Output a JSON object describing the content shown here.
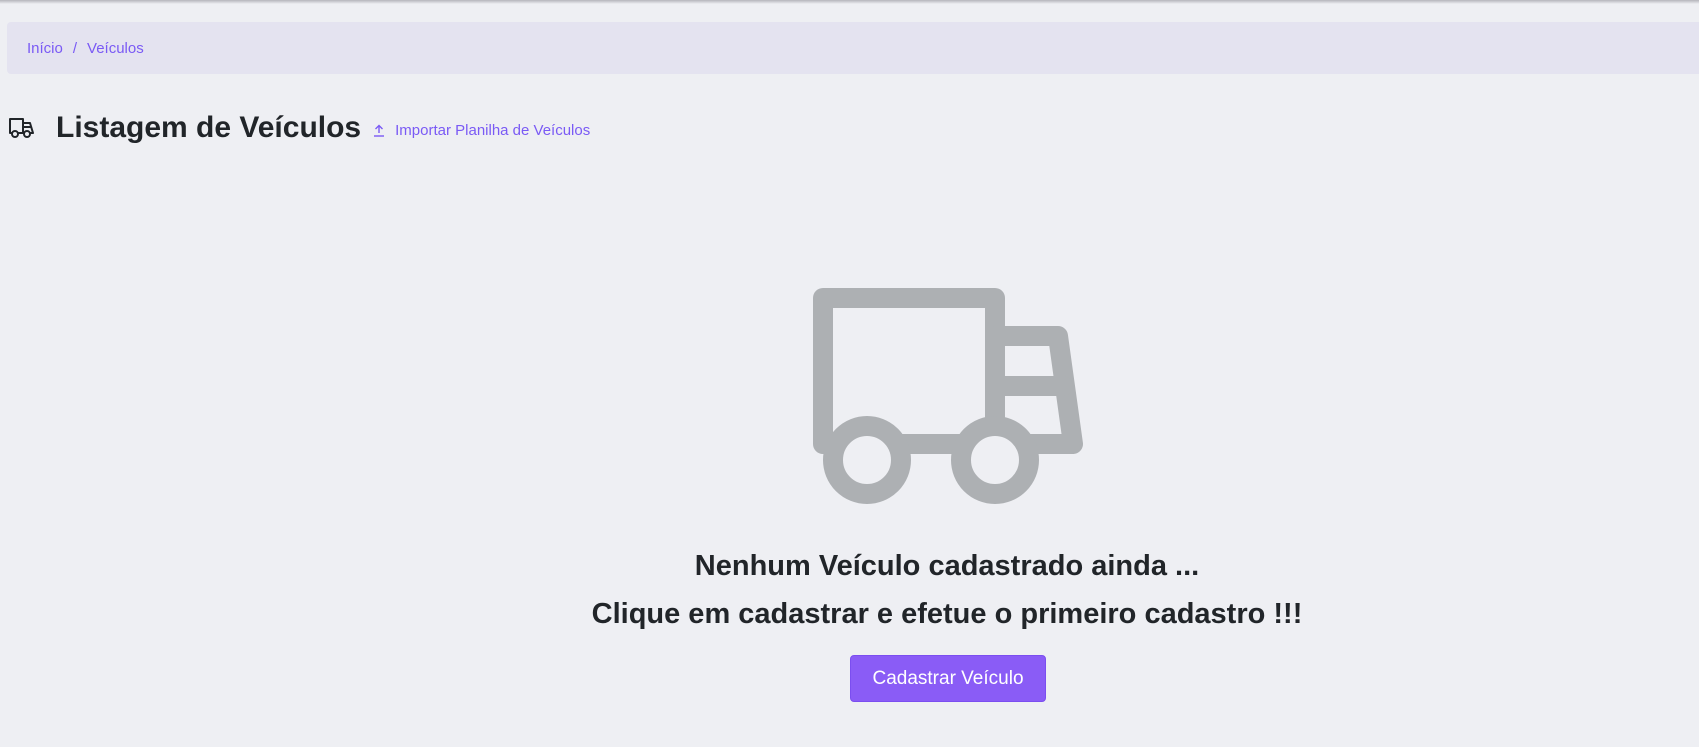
{
  "breadcrumb": {
    "items": [
      {
        "label": "Início"
      },
      {
        "label": "Veículos"
      }
    ],
    "separator": "/"
  },
  "header": {
    "icon": "truck-icon",
    "title": "Listagem de Veículos",
    "import_icon": "upload-icon",
    "import_label": "Importar Planilha de Veículos"
  },
  "empty_state": {
    "icon": "truck-icon",
    "line1": "Nenhum Veículo cadastrado ainda ...",
    "line2": "Clique em cadastrar e efetue o primeiro cadastro !!!",
    "button_label": "Cadastrar Veículo"
  },
  "colors": {
    "accent": "#8a5cf6",
    "link": "#7a5af5",
    "background": "#eeeff3",
    "breadcrumb_bg": "#e4e3f0",
    "icon_gray": "#adb0b3"
  }
}
